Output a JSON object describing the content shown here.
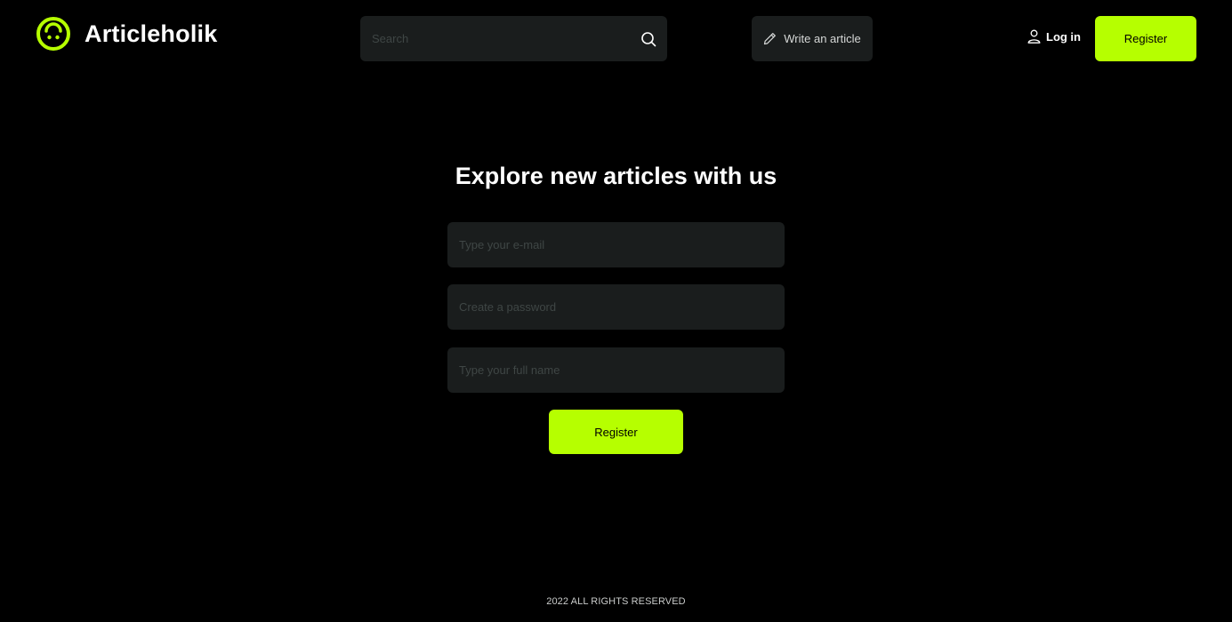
{
  "brand": {
    "name": "Articleholik",
    "accent_color": "#b6ff00",
    "logo_icon": "smiley-face-icon"
  },
  "header": {
    "search": {
      "placeholder": "Search",
      "value": "",
      "icon": "search-icon"
    },
    "write_article": {
      "label": "Write an article",
      "icon": "pencil-icon"
    },
    "login": {
      "label": "Log in",
      "icon": "user-icon"
    },
    "register": {
      "label": "Register"
    }
  },
  "main": {
    "title": "Explore new articles with us",
    "form": {
      "email": {
        "placeholder": "Type your e-mail",
        "value": ""
      },
      "password": {
        "placeholder": "Create a password",
        "value": ""
      },
      "full_name": {
        "placeholder": "Type your full name",
        "value": ""
      },
      "submit_label": "Register"
    }
  },
  "footer": {
    "text": "2022 ALL RIGHTS RESERVED"
  }
}
